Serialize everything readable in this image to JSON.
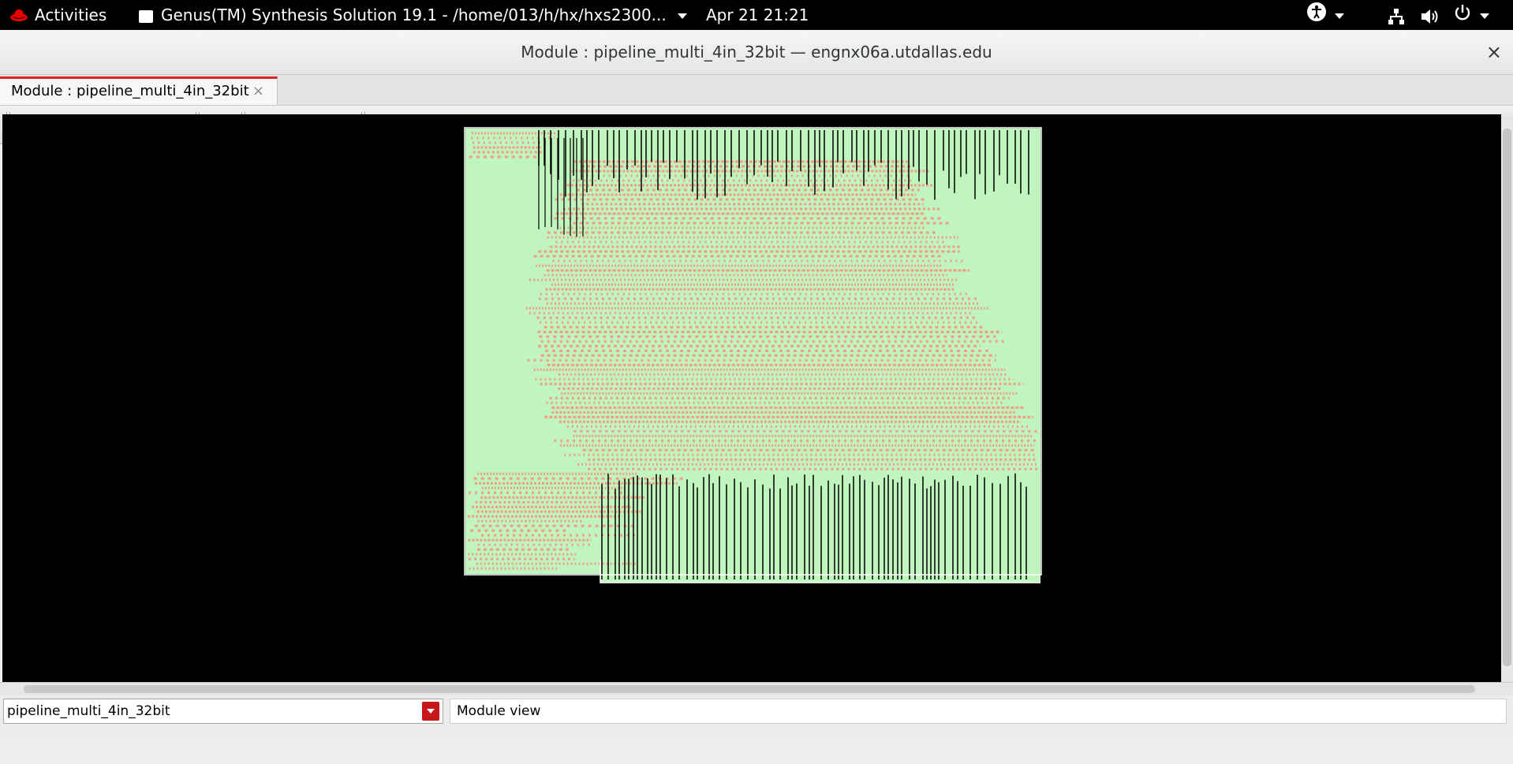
{
  "topbar": {
    "activities": "Activities",
    "app_title": "Genus(TM) Synthesis Solution 19.1 - /home/013/h/hx/hxs2300...",
    "datetime": "Apr 21  21:21",
    "icons": [
      "redhat-icon",
      "accessibility-icon",
      "network-icon",
      "volume-icon",
      "power-icon"
    ]
  },
  "window": {
    "title": "Module : pipeline_multi_4in_32bit — engnx06a.utdallas.edu",
    "close": "×"
  },
  "tab": {
    "label": "Module : pipeline_multi_4in_32bit",
    "close": "×"
  },
  "toolbar": {
    "buttons": [
      "zoom-in",
      "zoom-out",
      "zoom-fit",
      "refresh",
      "stop",
      "up-hierarchy",
      "back",
      "forward",
      "schematic",
      "select",
      "settings"
    ]
  },
  "canvas": {
    "colors": {
      "background": "#000000",
      "fill": "#c0f5c0",
      "cells": "#f29a82",
      "wires": "#000000"
    }
  },
  "status": {
    "module_select": "pipeline_multi_4in_32bit",
    "view_label": "Module view"
  }
}
